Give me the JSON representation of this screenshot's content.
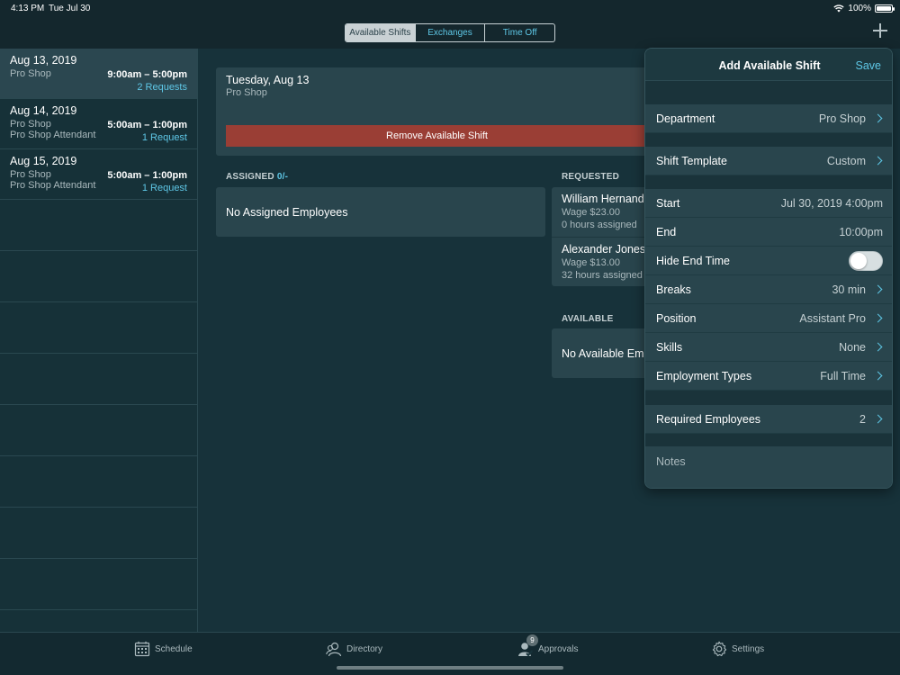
{
  "status": {
    "time": "4:13 PM",
    "date": "Tue Jul 30",
    "battery": "100%"
  },
  "nav": {
    "segments": [
      "Available Shifts",
      "Exchanges",
      "Time Off"
    ],
    "active_segment": "Available Shifts"
  },
  "shifts": [
    {
      "date": "Aug 13, 2019",
      "location": "Pro Shop",
      "position": "",
      "time": "9:00am – 5:00pm",
      "requests": "2 Requests"
    },
    {
      "date": "Aug 14, 2019",
      "location": "Pro Shop",
      "position": "Pro Shop Attendant",
      "time": "5:00am – 1:00pm",
      "requests": "1 Request"
    },
    {
      "date": "Aug 15, 2019",
      "location": "Pro Shop",
      "position": "Pro Shop Attendant",
      "time": "5:00am – 1:00pm",
      "requests": "1 Request"
    }
  ],
  "detail": {
    "title": "Tuesday, Aug 13",
    "subtitle": "Pro Shop",
    "remove_label": "Remove Available Shift",
    "assigned_label": "ASSIGNED",
    "assigned_count": "0/-",
    "assigned_empty": "No Assigned Employees",
    "requested_label": "REQUESTED",
    "requested": [
      {
        "name": "William Hernandez",
        "wage": "Wage $23.00",
        "hours": "0 hours assigned"
      },
      {
        "name": "Alexander Jones",
        "wage": "Wage $13.00",
        "hours": "32 hours assigned"
      }
    ],
    "available_label": "AVAILABLE",
    "available_empty": "No Available Employees"
  },
  "form": {
    "title": "Add Available Shift",
    "save": "Save",
    "department": {
      "label": "Department",
      "value": "Pro Shop"
    },
    "shift_template": {
      "label": "Shift Template",
      "value": "Custom"
    },
    "start": {
      "label": "Start",
      "value": "Jul 30, 2019 4:00pm"
    },
    "end": {
      "label": "End",
      "value": "10:00pm"
    },
    "hide_end_time": {
      "label": "Hide End Time",
      "on": false
    },
    "breaks": {
      "label": "Breaks",
      "value": "30 min"
    },
    "position": {
      "label": "Position",
      "value": "Assistant Pro"
    },
    "skills": {
      "label": "Skills",
      "value": "None"
    },
    "employment_types": {
      "label": "Employment Types",
      "value": "Full Time"
    },
    "required_employees": {
      "label": "Required Employees",
      "value": "2"
    },
    "notes_placeholder": "Notes"
  },
  "tabs": [
    {
      "label": "Schedule",
      "icon": "calendar-icon"
    },
    {
      "label": "Directory",
      "icon": "people-icon"
    },
    {
      "label": "Approvals",
      "icon": "approvals-icon",
      "badge": "9"
    },
    {
      "label": "Settings",
      "icon": "gear-icon"
    }
  ],
  "colors": {
    "accent": "#5ec7e6",
    "danger": "#9a3e35",
    "background": "#17323a"
  }
}
